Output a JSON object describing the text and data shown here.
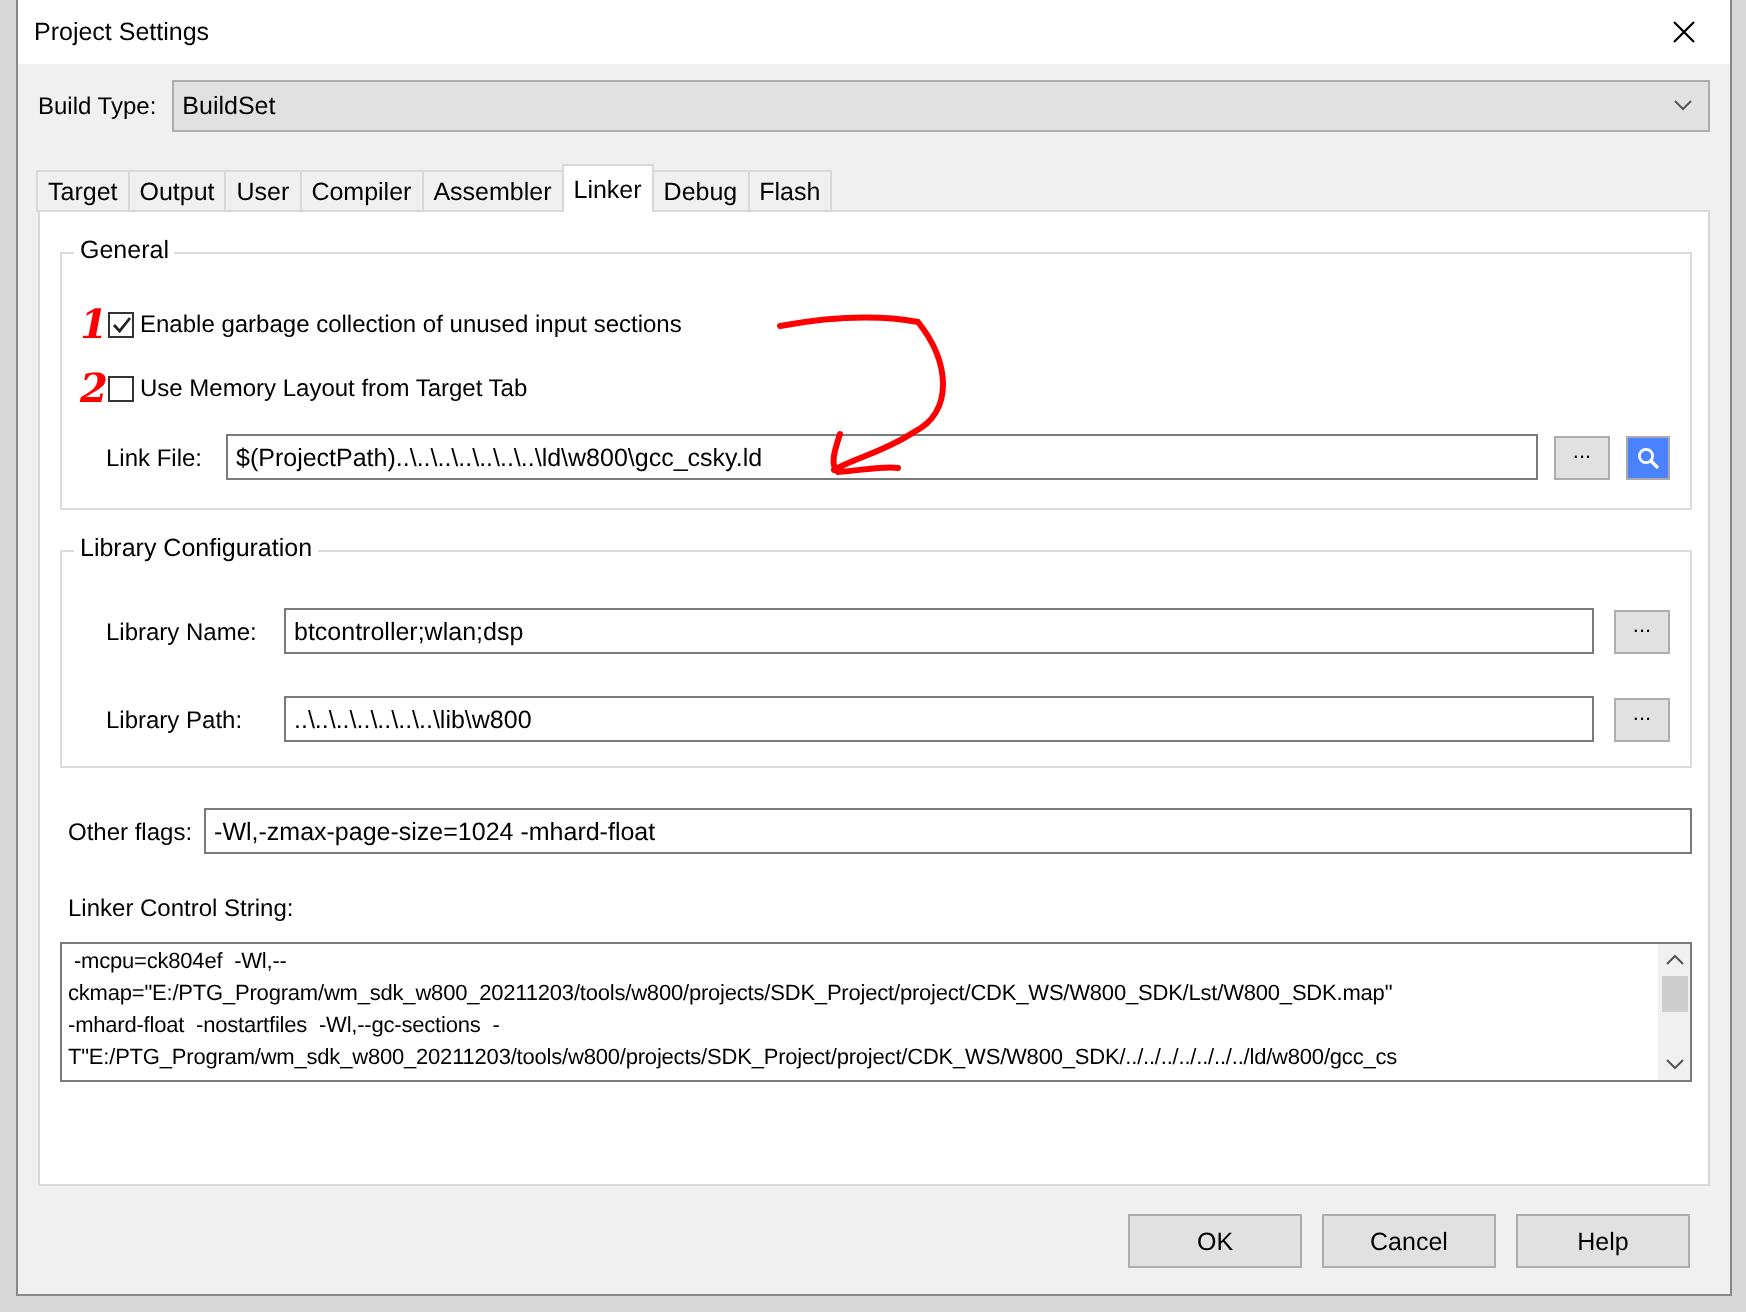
{
  "window": {
    "title": "Project Settings"
  },
  "build_type": {
    "label": "Build Type:",
    "value": "BuildSet"
  },
  "tabs": [
    {
      "label": "Target",
      "selected": false
    },
    {
      "label": "Output",
      "selected": false
    },
    {
      "label": "User",
      "selected": false
    },
    {
      "label": "Compiler",
      "selected": false
    },
    {
      "label": "Assembler",
      "selected": false
    },
    {
      "label": "Linker",
      "selected": true
    },
    {
      "label": "Debug",
      "selected": false
    },
    {
      "label": "Flash",
      "selected": false
    }
  ],
  "general": {
    "title": "General",
    "checkboxes": [
      {
        "label": "Enable garbage collection of unused input sections",
        "checked": true,
        "mark": "1"
      },
      {
        "label": "Use Memory Layout from Target Tab",
        "checked": false,
        "mark": "2"
      }
    ],
    "link_file": {
      "label": "Link File:",
      "value": "$(ProjectPath)..\\..\\..\\..\\..\\..\\..\\ld\\w800\\gcc_csky.ld",
      "browse": "..."
    }
  },
  "library": {
    "title": "Library Configuration",
    "fields": [
      {
        "label": "Library Name:",
        "value": "btcontroller;wlan;dsp",
        "browse": "..."
      },
      {
        "label": "Library Path:",
        "value": "..\\..\\..\\..\\..\\..\\..\\lib\\w800",
        "browse": "..."
      }
    ]
  },
  "other_flags": {
    "label": "Other flags:",
    "value": "-Wl,-zmax-page-size=1024 -mhard-float"
  },
  "control_string": {
    "label": "Linker Control String:",
    "lines": [
      " -mcpu=ck804ef  -Wl,--",
      "ckmap=\"E:/PTG_Program/wm_sdk_w800_20211203/tools/w800/projects/SDK_Project/project/CDK_WS/W800_SDK/Lst/W800_SDK.map\"",
      "-mhard-float  -nostartfiles  -Wl,--gc-sections  -",
      "T\"E:/PTG_Program/wm_sdk_w800_20211203/tools/w800/projects/SDK_Project/project/CDK_WS/W800_SDK/../../../../../../../ld/w800/gcc_cs"
    ]
  },
  "buttons": [
    "OK",
    "Cancel",
    "Help"
  ]
}
